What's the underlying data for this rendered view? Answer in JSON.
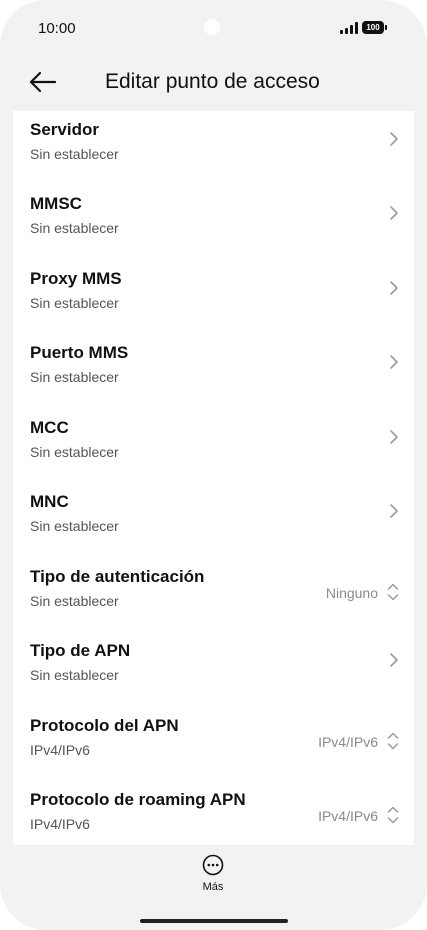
{
  "status_bar": {
    "time": "10:00",
    "battery": "100"
  },
  "header": {
    "title": "Editar punto de acceso",
    "back_icon": "arrow-left-icon"
  },
  "settings": [
    {
      "title": "Servidor",
      "subtitle": "Sin establecer",
      "value": "",
      "control": "chevron-right-icon"
    },
    {
      "title": "MMSC",
      "subtitle": "Sin establecer",
      "value": "",
      "control": "chevron-right-icon"
    },
    {
      "title": "Proxy MMS",
      "subtitle": "Sin establecer",
      "value": "",
      "control": "chevron-right-icon"
    },
    {
      "title": "Puerto MMS",
      "subtitle": "Sin establecer",
      "value": "",
      "control": "chevron-right-icon"
    },
    {
      "title": "MCC",
      "subtitle": "Sin establecer",
      "value": "",
      "control": "chevron-right-icon"
    },
    {
      "title": "MNC",
      "subtitle": "Sin establecer",
      "value": "",
      "control": "chevron-right-icon"
    },
    {
      "title": "Tipo de autenticación",
      "subtitle": "Sin establecer",
      "value": "Ninguno",
      "control": "up-down-icon"
    },
    {
      "title": "Tipo de APN",
      "subtitle": "Sin establecer",
      "value": "",
      "control": "chevron-right-icon"
    },
    {
      "title": "Protocolo del APN",
      "subtitle": "IPv4/IPv6",
      "value": "IPv4/IPv6",
      "control": "up-down-icon"
    },
    {
      "title": "Protocolo de roaming APN",
      "subtitle": "IPv4/IPv6",
      "value": "IPv4/IPv6",
      "control": "up-down-icon"
    }
  ],
  "bottom_bar": {
    "more_label": "Más",
    "more_icon": "more-dots-icon"
  },
  "colors": {
    "background": "#f2f2f2",
    "card": "#ffffff",
    "text_primary": "#111111",
    "text_secondary": "#555555",
    "value_text": "#8a8a8a",
    "icon": "#9a9a9a"
  }
}
